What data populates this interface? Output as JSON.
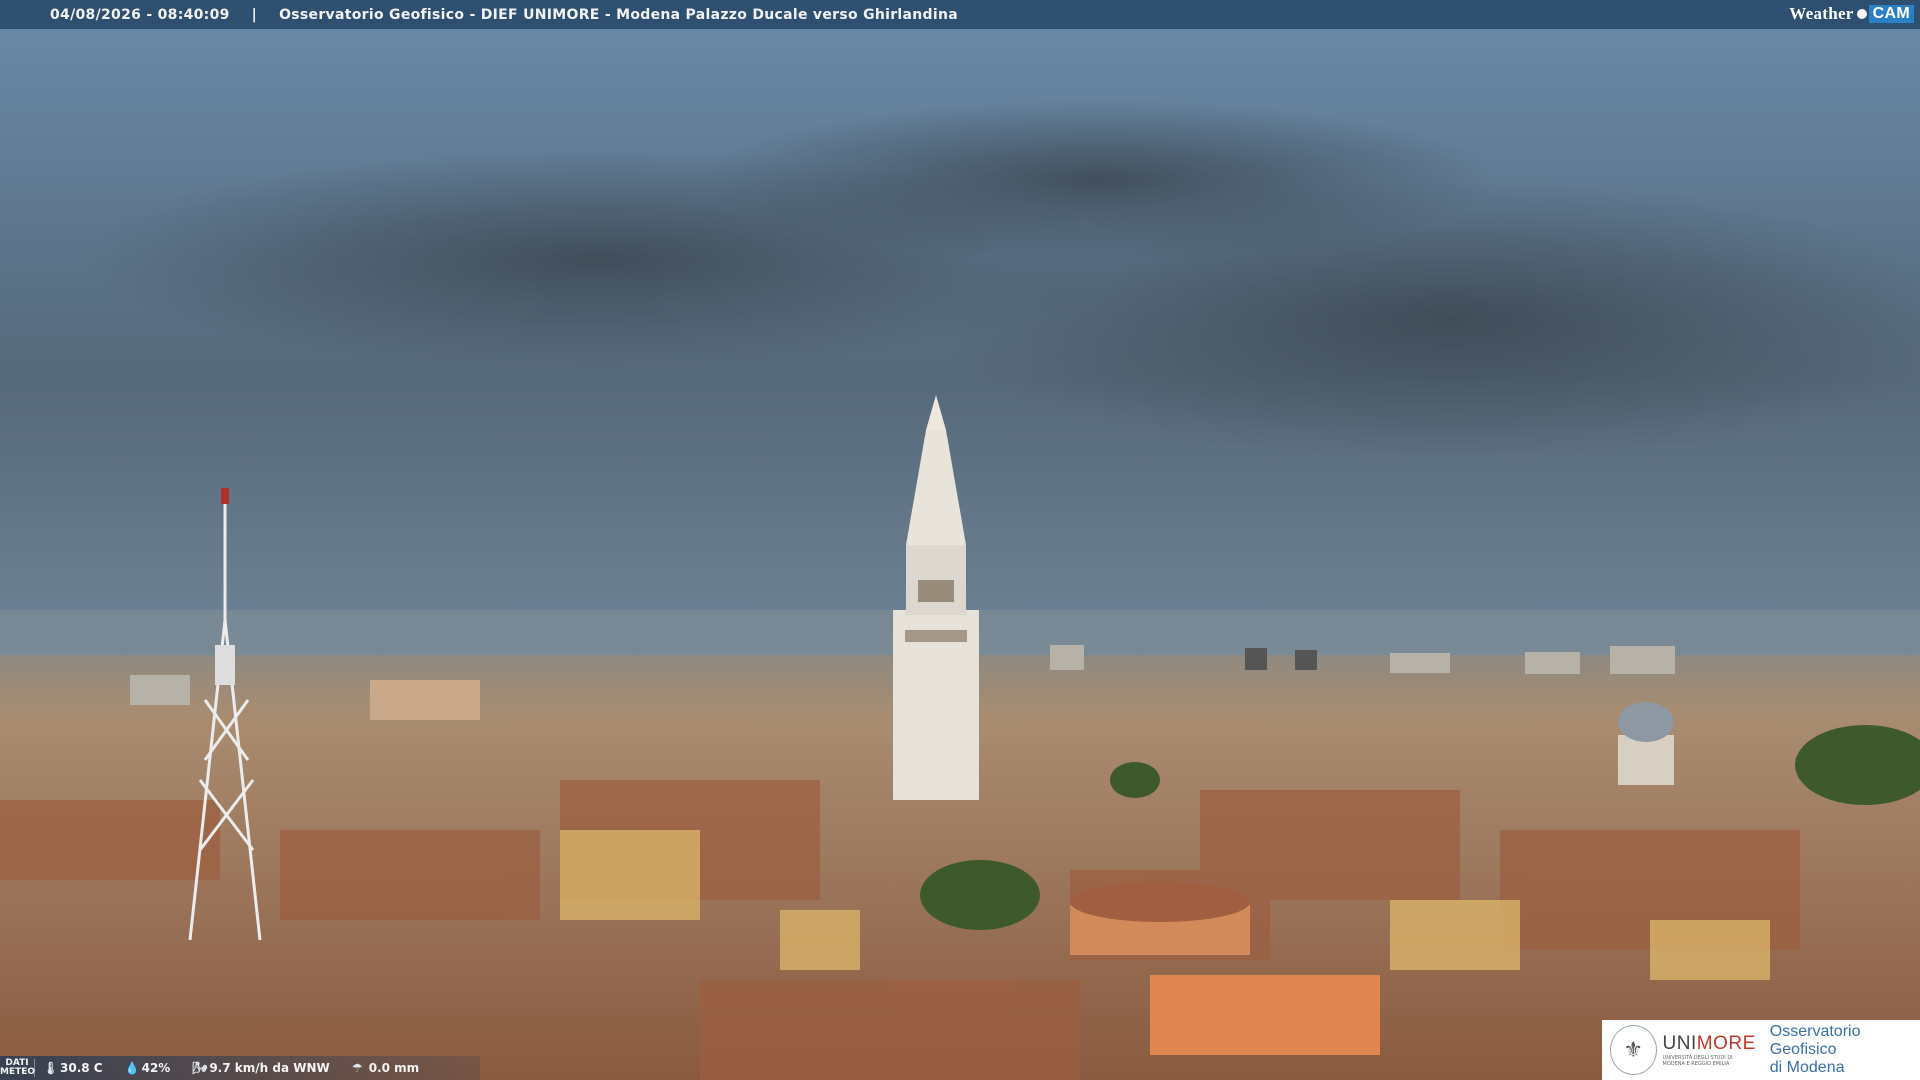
{
  "header": {
    "timestamp": "04/08/2026 - 08:40:09",
    "separator": "|",
    "title": "Osservatorio Geofisico - DIEF UNIMORE - Modena Palazzo Ducale verso Ghirlandina",
    "logo_text": "Weather",
    "logo_cam": "CAM"
  },
  "status": {
    "dati_label_1": "DATI",
    "dati_label_2": "METEO",
    "temperature": "30.8 C",
    "humidity": "42%",
    "wind": "9.7 km/h da WNW",
    "rain": "0.0 mm",
    "icons": [
      "thermometer-icon",
      "humidity-drop-icon",
      "wind-icon",
      "rain-icon"
    ]
  },
  "branding": {
    "uni_prefix": "UNI",
    "uni_suffix": "MORE",
    "uni_sub": "UNIVERSITÀ DEGLI STUDI DI MODENA E REGGIO EMILIA",
    "observatory_line1": "Osservatorio Geofisico",
    "observatory_line2": "di Modena"
  },
  "colors": {
    "topbar": "#2e4f6f",
    "sky_top": "#5e7e9e",
    "sky_dark": "#3f4f5c",
    "roof": "#a0644a",
    "unimore_red": "#c0392b",
    "observatory_blue": "#3a6ea8"
  }
}
